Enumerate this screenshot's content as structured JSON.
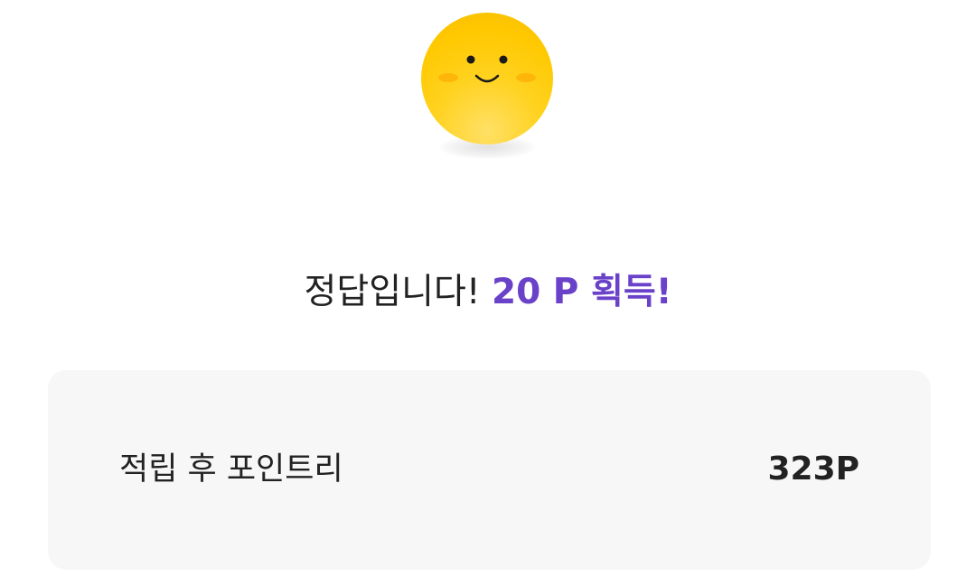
{
  "mascot": {
    "icon": "smiley-face-icon",
    "colors": {
      "face": "#ffc800",
      "face_highlight": "#ffe066",
      "eyes": "#1a1a1a",
      "cheeks": "#ffa000"
    }
  },
  "result": {
    "message": "정답입니다!",
    "reward": "20 P 획득!",
    "reward_color": "#6a41c9"
  },
  "points_card": {
    "label": "적립 후 포인트리",
    "value": "323P",
    "background": "#f7f7f7"
  }
}
